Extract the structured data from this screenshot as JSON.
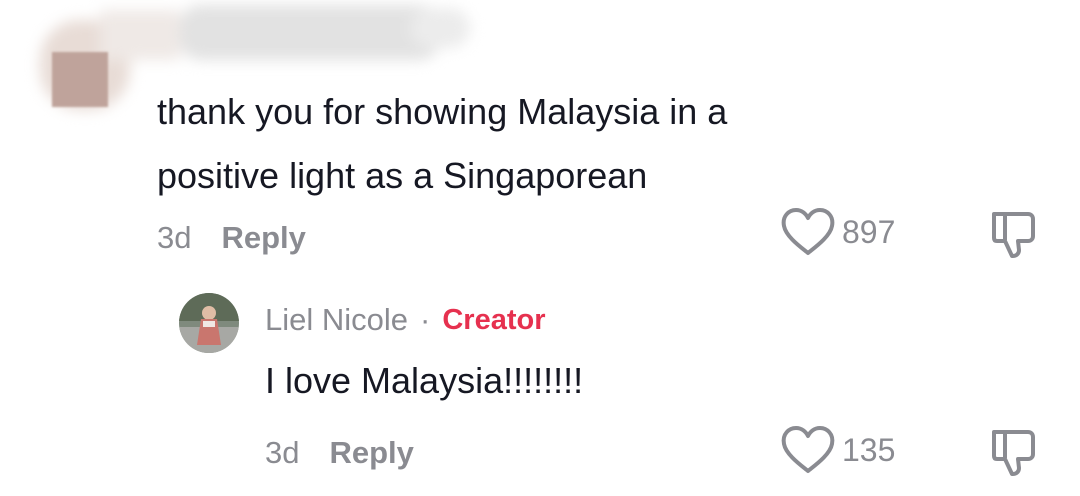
{
  "comment": {
    "text_line1": "thank you for showing Malaysia in a",
    "text_line2": "positive light as a Singaporean",
    "time": "3d",
    "reply_label": "Reply",
    "like_count": "897"
  },
  "reply": {
    "username": "Liel Nicole",
    "separator": "·",
    "badge": "Creator",
    "text": "I love Malaysia!!!!!!!!",
    "time": "3d",
    "reply_label": "Reply",
    "like_count": "135"
  },
  "colors": {
    "text": "#161823",
    "muted": "#8a8b91",
    "creator_badge": "#e6314f"
  },
  "icons": {
    "like": "heart-outline-icon",
    "dislike": "thumbs-down-icon"
  }
}
